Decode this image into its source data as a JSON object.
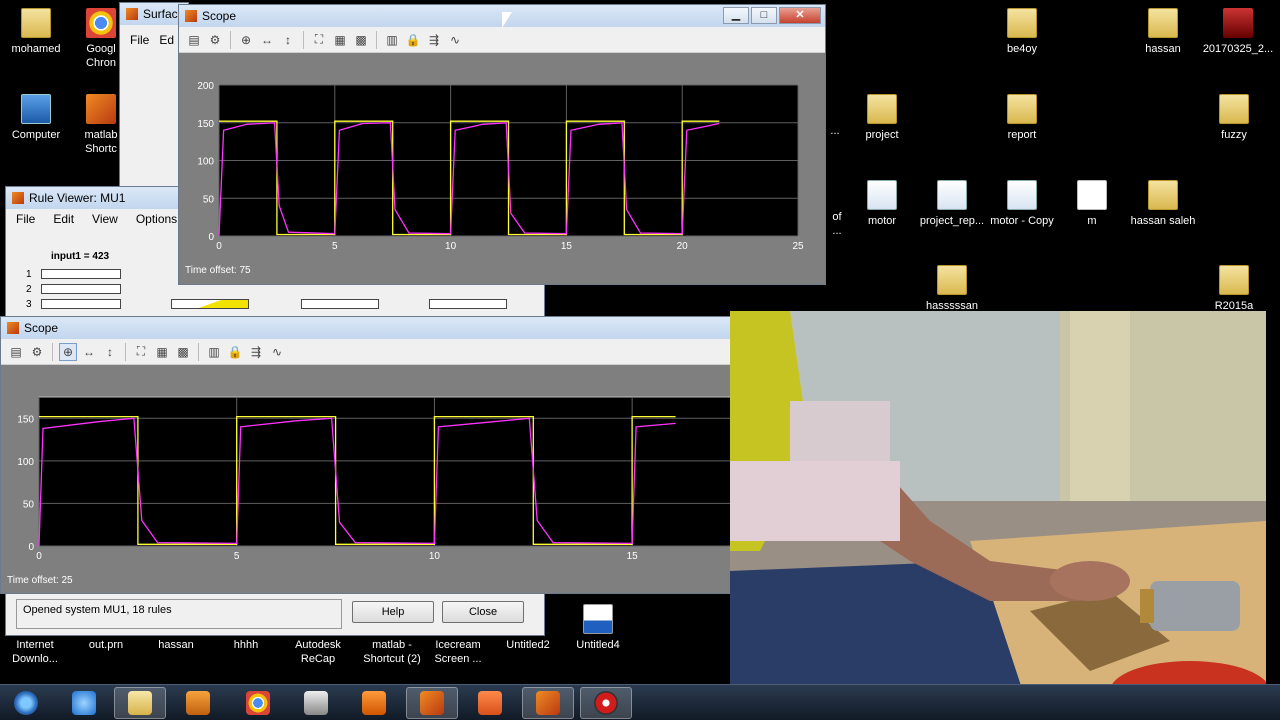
{
  "desktop_icons": [
    {
      "label": "mohamed",
      "kind": "folder"
    },
    {
      "label": "Googl Chron",
      "kind": "chrome"
    },
    {
      "label": "Computer",
      "kind": "pc"
    },
    {
      "label": "matlab Shortc",
      "kind": "matlab"
    },
    {
      "label": "be4oy",
      "kind": "folder"
    },
    {
      "label": "hassan",
      "kind": "folder"
    },
    {
      "label": "20170325_2...",
      "kind": "app"
    },
    {
      "label": "...",
      "kind": "none"
    },
    {
      "label": "project",
      "kind": "folder"
    },
    {
      "label": "report",
      "kind": "folder"
    },
    {
      "label": "fuzzy",
      "kind": "folder"
    },
    {
      "label": "of ...",
      "kind": "none"
    },
    {
      "label": "motor",
      "kind": "mfile"
    },
    {
      "label": "project_rep...",
      "kind": "mfile"
    },
    {
      "label": "motor - Copy",
      "kind": "mfile"
    },
    {
      "label": "m",
      "kind": "doc"
    },
    {
      "label": "hassan saleh",
      "kind": "folder"
    },
    {
      "label": "hasssssan",
      "kind": "folder"
    },
    {
      "label": "R2015a",
      "kind": "folder"
    },
    {
      "label": "Internet Downlo...",
      "kind": "none"
    },
    {
      "label": "out.prn",
      "kind": "none"
    },
    {
      "label": "hassan",
      "kind": "none"
    },
    {
      "label": "hhhh",
      "kind": "none"
    },
    {
      "label": "Autodesk ReCap",
      "kind": "none"
    },
    {
      "label": "matlab - Shortcut (2)",
      "kind": "none"
    },
    {
      "label": "Icecream Screen ...",
      "kind": "none"
    },
    {
      "label": "Untitled2",
      "kind": "none"
    },
    {
      "label": "Untitled4",
      "kind": "cpp"
    }
  ],
  "surface_window": {
    "title": "Surfac",
    "menu_file": "File",
    "menu_edit": "Ed"
  },
  "rule_viewer": {
    "title": "Rule Viewer: MU1",
    "menus": [
      "File",
      "Edit",
      "View",
      "Options"
    ],
    "input_label": "input1 = 423",
    "rule_numbers": [
      "1",
      "2",
      "3"
    ],
    "status": "Opened system MU1, 18 rules",
    "help": "Help",
    "close": "Close"
  },
  "scope_top": {
    "title": "Scope",
    "time_offset": "Time offset:  75"
  },
  "scope_bottom": {
    "title": "Scope",
    "time_offset": "Time offset:  25"
  },
  "cursor_icon": "arrow-cursor-icon",
  "colors": {
    "setpoint": "#ffff33",
    "response": "#ff33ff",
    "grid": "#606060",
    "scope_bg": "#7f7f7f"
  },
  "chart_data": [
    {
      "type": "line",
      "title": "",
      "xlim": [
        0,
        25
      ],
      "ylim": [
        0,
        200
      ],
      "xticks": [
        0,
        5,
        10,
        15,
        20,
        25
      ],
      "yticks": [
        0,
        50,
        100,
        150,
        200
      ],
      "series": [
        {
          "color": "#ffff33",
          "x": [
            0,
            2.5,
            2.5,
            5,
            5,
            7.5,
            7.5,
            10,
            10,
            12.5,
            12.5,
            15,
            15,
            17.5,
            17.5,
            20,
            20,
            21.6
          ],
          "y": [
            152,
            152,
            2,
            2,
            152,
            152,
            2,
            2,
            152,
            152,
            2,
            2,
            152,
            152,
            2,
            2,
            152,
            152
          ]
        },
        {
          "color": "#ff33ff",
          "x": [
            0,
            0.2,
            1.2,
            2.4,
            2.6,
            3,
            5,
            5.2,
            6.2,
            7.4,
            7.6,
            8.2,
            10,
            10.2,
            11.4,
            12.4,
            12.6,
            13.2,
            15,
            15.2,
            16.4,
            17.4,
            17.6,
            18.2,
            20,
            20.2,
            21.6
          ],
          "y": [
            0,
            140,
            148,
            150,
            40,
            5,
            3,
            140,
            149,
            150,
            35,
            4,
            3,
            140,
            148,
            150,
            30,
            4,
            3,
            140,
            148,
            150,
            35,
            4,
            3,
            140,
            149
          ]
        }
      ]
    },
    {
      "type": "line",
      "title": "",
      "xlim": [
        0,
        17.5
      ],
      "ylim": [
        0,
        175
      ],
      "xticks": [
        0,
        5,
        10,
        15
      ],
      "yticks": [
        0,
        50,
        100,
        150
      ],
      "series": [
        {
          "color": "#ffff33",
          "x": [
            0,
            2.5,
            2.5,
            5,
            5,
            7.5,
            7.5,
            10,
            10,
            12.5,
            12.5,
            15,
            15,
            16.1
          ],
          "y": [
            152,
            152,
            2,
            2,
            152,
            152,
            2,
            2,
            152,
            152,
            2,
            2,
            152,
            152
          ]
        },
        {
          "color": "#ff33ff",
          "x": [
            0,
            0.1,
            1.5,
            2.4,
            2.6,
            3,
            5,
            5.1,
            6.5,
            7.4,
            7.6,
            8,
            10,
            10.1,
            11.5,
            12.4,
            12.6,
            13,
            15,
            15.1,
            16.1
          ],
          "y": [
            0,
            138,
            146,
            150,
            30,
            4,
            3,
            140,
            147,
            150,
            28,
            4,
            3,
            140,
            146,
            150,
            30,
            4,
            3,
            140,
            144
          ]
        }
      ]
    }
  ]
}
